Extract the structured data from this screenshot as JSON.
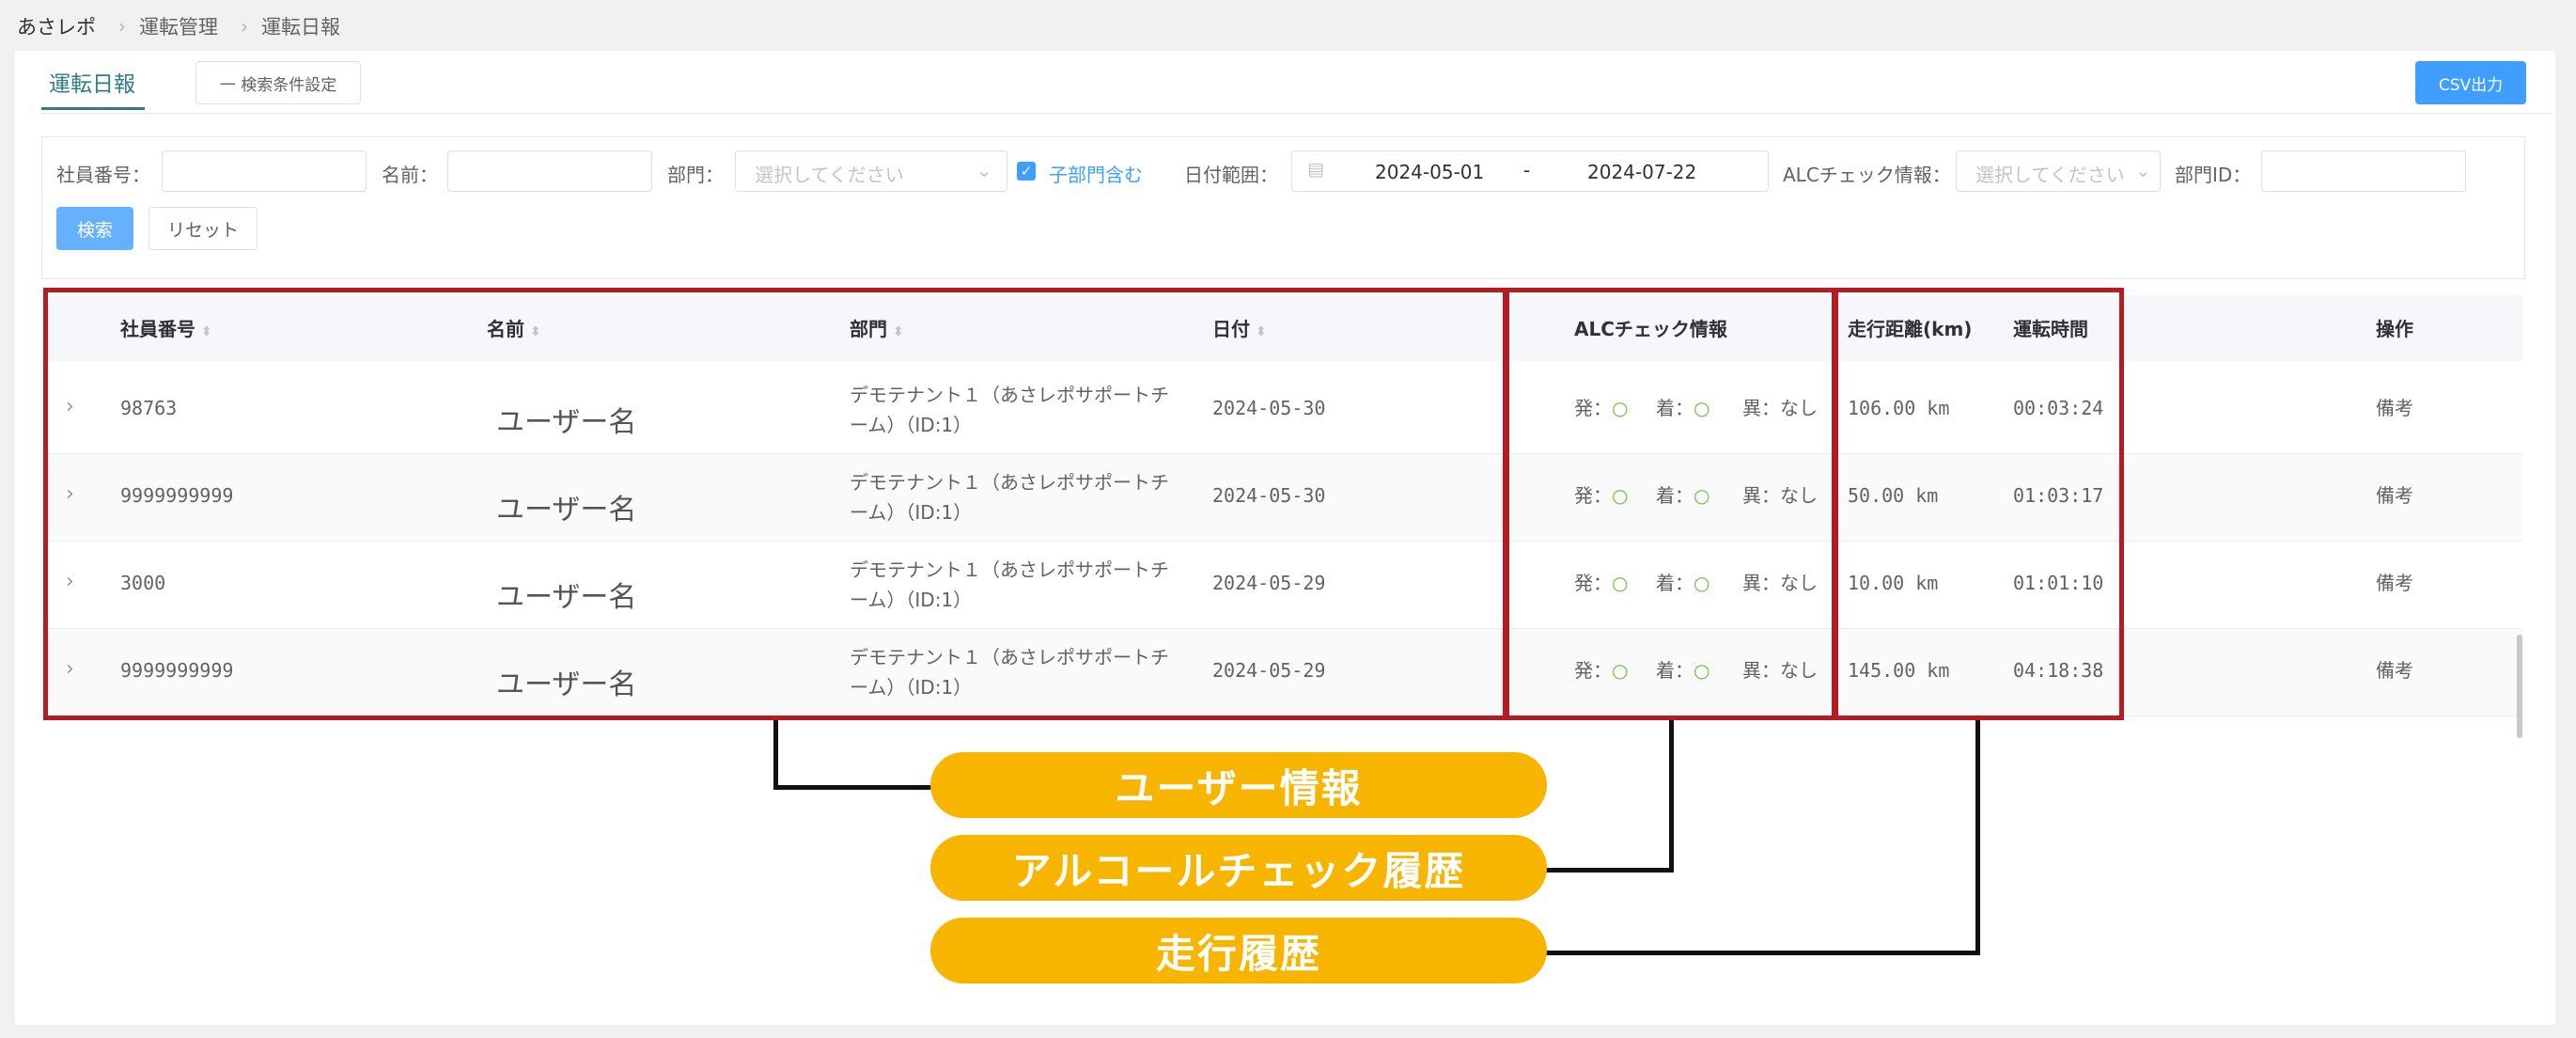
{
  "breadcrumb": [
    "あさレポ",
    "運転管理",
    "運転日報"
  ],
  "tab_label": "運転日報",
  "search_settings_label": "一 検索条件設定",
  "csv_label": "CSV出力",
  "filters": {
    "employee_no_label": "社員番号：",
    "name_label": "名前：",
    "dept_label": "部門：",
    "dept_placeholder": "選択してください",
    "include_sub_label": "子部門含む",
    "date_range_label": "日付範囲：",
    "date_start": "2024-05-01",
    "date_sep": "-",
    "date_end": "2024-07-22",
    "alc_label": "ALCチェック情報：",
    "alc_placeholder": "選択してください",
    "dept_id_label": "部門ID："
  },
  "search_label": "検索",
  "reset_label": "リセット",
  "columns": [
    "社員番号",
    "名前",
    "部門",
    "日付",
    "ALCチェック情報",
    "走行距離(km)",
    "運転時間",
    "操作"
  ],
  "rows": [
    {
      "emp": "98763",
      "name": "ユーザー名",
      "dept1": "デモテナント１（あさレポサポートチ",
      "dept2": "ーム）（ID:1）",
      "date": "2024-05-30",
      "dep": "発：",
      "arr": "着：",
      "abn": "異：なし",
      "dist": "106.00 km",
      "time": "00:03:24",
      "action": "備考"
    },
    {
      "emp": "9999999999",
      "name": "ユーザー名",
      "dept1": "デモテナント１（あさレポサポートチ",
      "dept2": "ーム）（ID:1）",
      "date": "2024-05-30",
      "dep": "発：",
      "arr": "着：",
      "abn": "異：なし",
      "dist": "50.00 km",
      "time": "01:03:17",
      "action": "備考"
    },
    {
      "emp": "3000",
      "name": "ユーザー名",
      "dept1": "デモテナント１（あさレポサポートチ",
      "dept2": "ーム）（ID:1）",
      "date": "2024-05-29",
      "dep": "発：",
      "arr": "着：",
      "abn": "異：なし",
      "dist": "10.00 km",
      "time": "01:01:10",
      "action": "備考"
    },
    {
      "emp": "9999999999",
      "name": "ユーザー名",
      "dept1": "デモテナント１（あさレポサポートチ",
      "dept2": "ーム）（ID:1）",
      "date": "2024-05-29",
      "dep": "発：",
      "arr": "着：",
      "abn": "異：なし",
      "dist": "145.00 km",
      "time": "04:18:38",
      "action": "備考"
    }
  ],
  "callouts": [
    "ユーザー情報",
    "アルコールチェック履歴",
    "走行履歴"
  ],
  "colors": {
    "accent": "#409eff",
    "tab": "#2f7d83",
    "highlight": "#b41b23",
    "callout": "#f7b500"
  }
}
